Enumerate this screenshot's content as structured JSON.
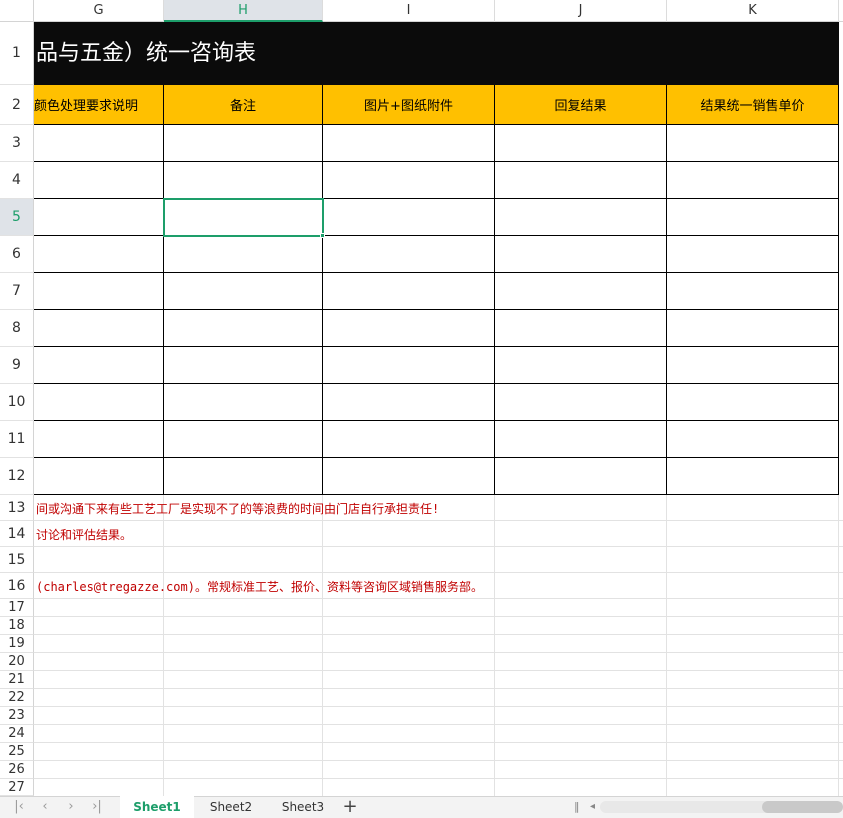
{
  "columns": [
    "G",
    "H",
    "I",
    "J",
    "K"
  ],
  "selected_column": "H",
  "rows": [
    "1",
    "2",
    "3",
    "4",
    "5",
    "6",
    "7",
    "8",
    "9",
    "10",
    "11",
    "12",
    "13",
    "14",
    "15",
    "16",
    "17",
    "18",
    "19",
    "20",
    "21",
    "22",
    "23",
    "24",
    "25",
    "26",
    "27"
  ],
  "selected_row": "5",
  "title": "品与五金）统一咨询表",
  "headers": [
    "颜色处理要求说明",
    "备注",
    "图片+图纸附件",
    "回复结果",
    "结果统一销售单价"
  ],
  "notes": {
    "row13": "间或沟通下来有些工艺工厂是实现不了的等浪费的时间由门店自行承担责任!",
    "row14": "讨论和评估结果。",
    "row16": "(charles@tregazze.com)。常规标准工艺、报价、资料等咨询区域销售服务部。"
  },
  "colors": {
    "title_bg": "#0b0b0b",
    "header_bg": "#ffc000",
    "accent": "#1d9e6a",
    "note_text": "#c00000"
  },
  "sheets": [
    "Sheet1",
    "Sheet2",
    "Sheet3"
  ],
  "active_sheet": "Sheet1",
  "nav_icons": [
    "first-sheet-icon",
    "prev-sheet-icon",
    "next-sheet-icon",
    "last-sheet-icon"
  ],
  "add_sheet_icon": "plus-icon"
}
